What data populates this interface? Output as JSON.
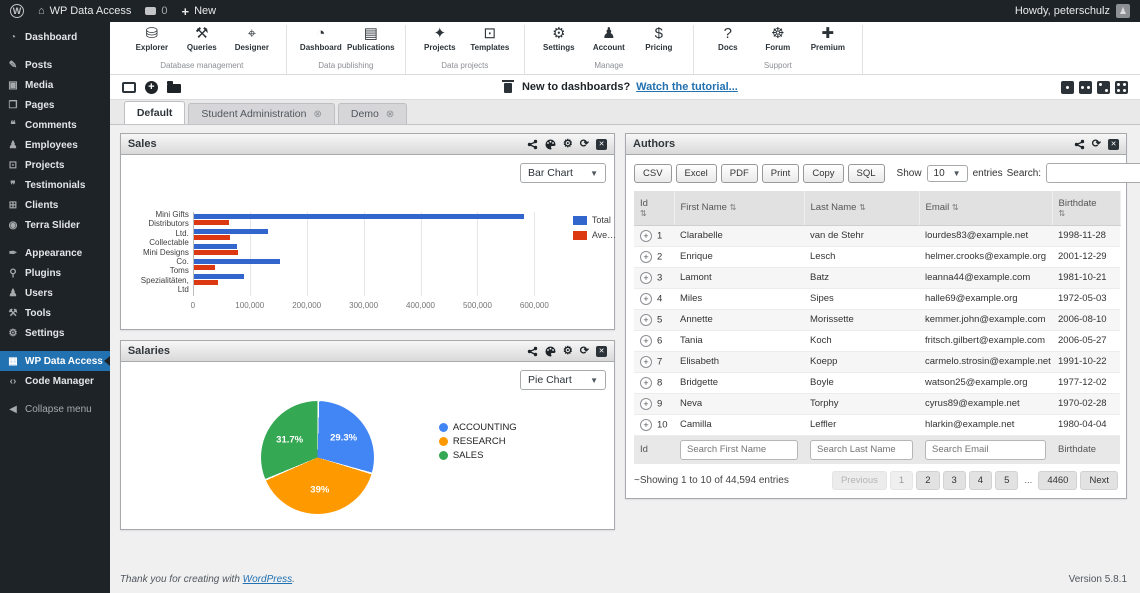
{
  "admin_bar": {
    "site": "WP Data Access",
    "comments_count": "0",
    "new_label": "New",
    "howdy": "Howdy, peterschulz"
  },
  "sidebar": {
    "items": [
      {
        "label": "Dashboard",
        "icon": "dashboard-icon",
        "glyph": "◔"
      },
      {
        "label": "Posts",
        "icon": "posts-icon",
        "glyph": "✎",
        "gap_before": true
      },
      {
        "label": "Media",
        "icon": "media-icon",
        "glyph": "▣"
      },
      {
        "label": "Pages",
        "icon": "pages-icon",
        "glyph": "❐"
      },
      {
        "label": "Comments",
        "icon": "comments-icon",
        "glyph": "❝"
      },
      {
        "label": "Employees",
        "icon": "employees-icon",
        "glyph": "♟"
      },
      {
        "label": "Projects",
        "icon": "projects-icon",
        "glyph": "⊡"
      },
      {
        "label": "Testimonials",
        "icon": "testimonials-icon",
        "glyph": "❞"
      },
      {
        "label": "Clients",
        "icon": "clients-icon",
        "glyph": "⊞"
      },
      {
        "label": "Terra Slider",
        "icon": "terra-slider-icon",
        "glyph": "◉"
      },
      {
        "label": "Appearance",
        "icon": "appearance-icon",
        "glyph": "✒",
        "gap_before": true
      },
      {
        "label": "Plugins",
        "icon": "plugins-icon",
        "glyph": "⚲"
      },
      {
        "label": "Users",
        "icon": "users-icon",
        "glyph": "♟"
      },
      {
        "label": "Tools",
        "icon": "tools-icon",
        "glyph": "⚒"
      },
      {
        "label": "Settings",
        "icon": "settings-icon",
        "glyph": "⚙"
      },
      {
        "label": "WP Data Access",
        "icon": "wp-data-access-icon",
        "glyph": "▦",
        "active": true,
        "gap_before": true
      },
      {
        "label": "Code Manager",
        "icon": "code-icon",
        "glyph": "‹›"
      },
      {
        "label": "Collapse menu",
        "icon": "collapse-arrow-icon",
        "glyph": "◀",
        "dim": true,
        "gap_before": true
      }
    ]
  },
  "ribbon": {
    "groups": [
      {
        "label": "Database management",
        "items": [
          {
            "label": "Explorer",
            "icon": "database-icon",
            "glyph": "⛁"
          },
          {
            "label": "Queries",
            "icon": "query-tools-icon",
            "glyph": "⚒"
          },
          {
            "label": "Designer",
            "icon": "designer-compass-icon",
            "glyph": "⌖"
          }
        ]
      },
      {
        "label": "Data publishing",
        "items": [
          {
            "label": "Dashboard",
            "icon": "gauge-icon",
            "glyph": "◔"
          },
          {
            "label": "Publications",
            "icon": "publication-card-icon",
            "glyph": "▤"
          }
        ]
      },
      {
        "label": "Data projects",
        "items": [
          {
            "label": "Projects",
            "icon": "magic-wand-icon",
            "glyph": "✦"
          },
          {
            "label": "Templates",
            "icon": "monitor-icon",
            "glyph": "⊡"
          }
        ]
      },
      {
        "label": "Manage",
        "items": [
          {
            "label": "Settings",
            "icon": "gear-icon",
            "glyph": "⚙"
          },
          {
            "label": "Account",
            "icon": "user-icon",
            "glyph": "♟"
          },
          {
            "label": "Pricing",
            "icon": "pricing-dollar-icon",
            "glyph": "$"
          }
        ]
      },
      {
        "label": "Support",
        "items": [
          {
            "label": "Docs",
            "icon": "question-icon",
            "glyph": "?"
          },
          {
            "label": "Forum",
            "icon": "lifebuoy-icon",
            "glyph": "☸"
          },
          {
            "label": "Premium",
            "icon": "premium-support-icon",
            "glyph": "✚"
          }
        ]
      }
    ]
  },
  "dashboard_toolbar": {
    "tutorial_prefix": "New to dashboards?",
    "tutorial_link": "Watch the tutorial...",
    "left_icons": [
      "new-dashboard-icon",
      "add-panel-icon",
      "open-dashboard-icon"
    ],
    "layout_icons": [
      "layout-1-column-icon",
      "layout-2-column-icon",
      "layout-mixed-icon",
      "layout-4-panel-icon"
    ]
  },
  "tabs": [
    {
      "label": "Default",
      "active": true
    },
    {
      "label": "Student Administration",
      "closable": true
    },
    {
      "label": "Demo",
      "closable": true
    }
  ],
  "panels": {
    "sales": {
      "title": "Sales",
      "chart_type": "Bar Chart"
    },
    "salaries": {
      "title": "Salaries",
      "chart_type": "Pie Chart"
    },
    "authors": {
      "title": "Authors",
      "export_buttons": [
        "CSV",
        "Excel",
        "PDF",
        "Print",
        "Copy",
        "SQL"
      ],
      "length": {
        "show": "Show",
        "value": "10",
        "entries": "entries"
      },
      "search_label": "Search:",
      "search_value": "",
      "table": {
        "sort_glyph": "⇅",
        "columns": [
          {
            "label": "Id"
          },
          {
            "label": "First Name"
          },
          {
            "label": "Last Name"
          },
          {
            "label": "Email"
          },
          {
            "label": "Birthdate"
          }
        ],
        "rows": [
          {
            "id": "1",
            "first_name": "Clarabelle",
            "last_name": "van de Stehr",
            "email": "lourdes83@example.net",
            "birthdate": "1998-11-28"
          },
          {
            "id": "2",
            "first_name": "Enrique",
            "last_name": "Lesch",
            "email": "helmer.crooks@example.org",
            "birthdate": "2001-12-29"
          },
          {
            "id": "3",
            "first_name": "Lamont",
            "last_name": "Batz",
            "email": "leanna44@example.com",
            "birthdate": "1981-10-21"
          },
          {
            "id": "4",
            "first_name": "Miles",
            "last_name": "Sipes",
            "email": "halle69@example.org",
            "birthdate": "1972-05-03"
          },
          {
            "id": "5",
            "first_name": "Annette",
            "last_name": "Morissette",
            "email": "kemmer.john@example.com",
            "birthdate": "2006-08-10"
          },
          {
            "id": "6",
            "first_name": "Tania",
            "last_name": "Koch",
            "email": "fritsch.gilbert@example.com",
            "birthdate": "2006-05-27"
          },
          {
            "id": "7",
            "first_name": "Elisabeth",
            "last_name": "Koepp",
            "email": "carmelo.strosin@example.net",
            "birthdate": "1991-10-22"
          },
          {
            "id": "8",
            "first_name": "Bridgette",
            "last_name": "Boyle",
            "email": "watson25@example.org",
            "birthdate": "1977-12-02"
          },
          {
            "id": "9",
            "first_name": "Neva",
            "last_name": "Torphy",
            "email": "cyrus89@example.net",
            "birthdate": "1970-02-28"
          },
          {
            "id": "10",
            "first_name": "Camilla",
            "last_name": "Leffler",
            "email": "hlarkin@example.net",
            "birthdate": "1980-04-04"
          }
        ],
        "filters": {
          "id_label": "Id",
          "placeholders": [
            "Search First Name",
            "Search Last Name",
            "Search Email"
          ],
          "birthdate_label": "Birthdate"
        }
      },
      "info": "~Showing 1 to 10 of 44,594 entries",
      "pagination": {
        "previous": "Previous",
        "pages": [
          "1",
          "2",
          "3",
          "4",
          "5"
        ],
        "current": "1",
        "ellipsis": "...",
        "last_page": "4460",
        "next": "Next"
      }
    }
  },
  "chart_data": [
    {
      "type": "bar",
      "orientation": "horizontal",
      "title": "Sales",
      "categories": [
        "Mini Gifts Distributors Ltd.",
        "",
        "Collectable Mini Designs Co.",
        "",
        "Toms Spezialitäten, Ltd"
      ],
      "axis_label_lines": [
        "Mini Gifts",
        "Distributors",
        "Ltd.",
        "Collectable",
        "Mini Designs",
        "Co.",
        "Toms",
        "Spezialitäten,",
        "Ltd"
      ],
      "series": [
        {
          "name": "Total",
          "color": "#3366CC",
          "values": [
            580000,
            130000,
            76000,
            151000,
            88000
          ]
        },
        {
          "name": "Ave…",
          "color": "#DC3912",
          "values": [
            62000,
            63000,
            78000,
            38000,
            42000
          ]
        }
      ],
      "xlim": [
        0,
        650000
      ],
      "xtick_step": 100000,
      "xticks": [
        "0",
        "100,000",
        "200,000",
        "300,000",
        "400,000",
        "500,000",
        "600,000"
      ],
      "grid": true,
      "legend_position": "right"
    },
    {
      "type": "pie",
      "title": "Salaries",
      "slices": [
        {
          "label": "ACCOUNTING",
          "value": 29.3,
          "color": "#4285F4",
          "data_label": "29.3%"
        },
        {
          "label": "RESEARCH",
          "value": 39,
          "color": "#FF9900",
          "data_label": "39%"
        },
        {
          "label": "SALES",
          "value": 31.7,
          "color": "#34A853",
          "data_label": "31.7%"
        }
      ],
      "legend_position": "right"
    }
  ],
  "footer": {
    "thanks_prefix": "Thank you for creating with",
    "thanks_link": "WordPress",
    "thanks_suffix": ".",
    "version": "Version 5.8.1"
  },
  "colors": {
    "accent": "#2271b1",
    "admin_bar_bg": "#1d2327"
  }
}
